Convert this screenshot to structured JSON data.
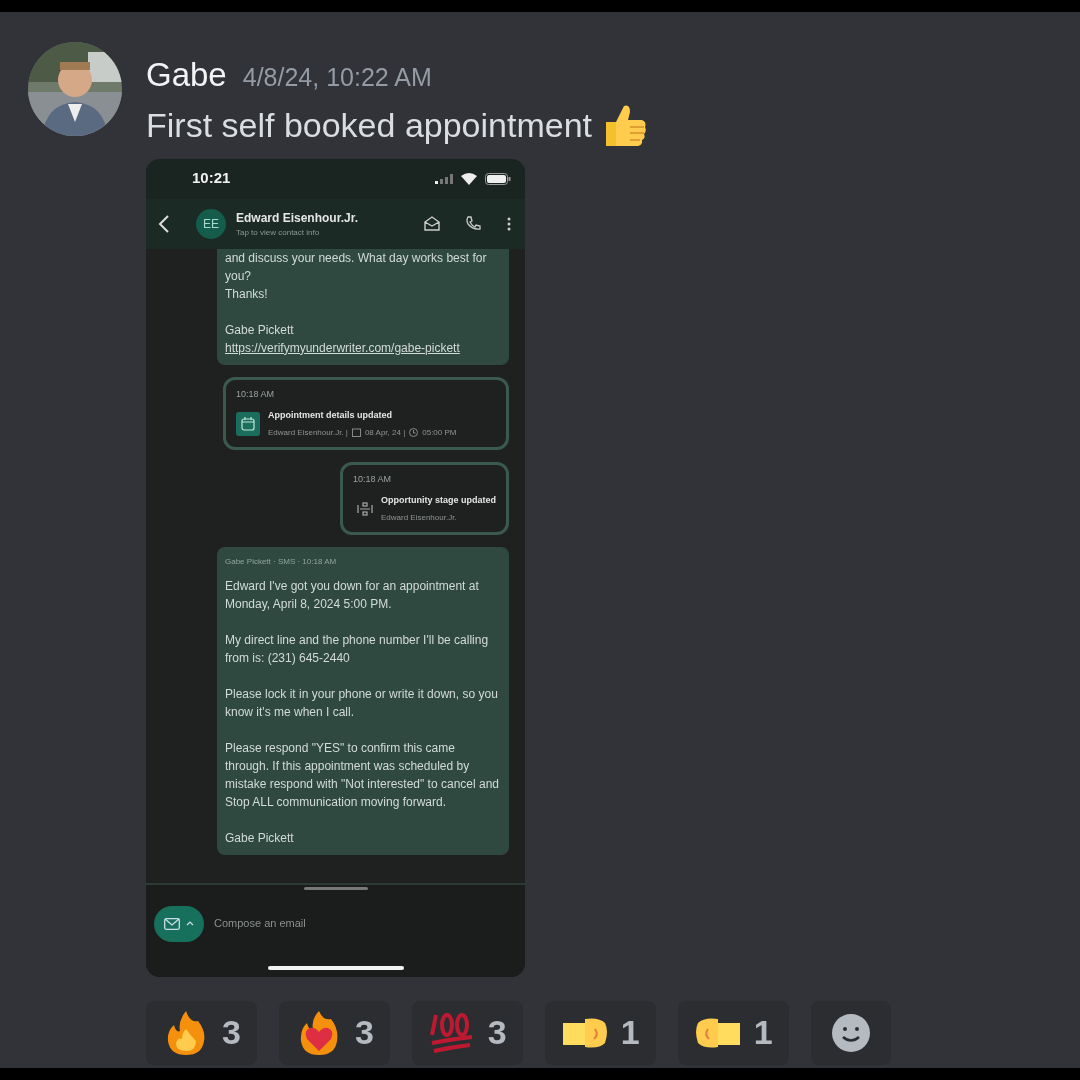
{
  "message": {
    "author": "Gabe",
    "timestamp": "4/8/24, 10:22 AM",
    "text": "First self booked appointment"
  },
  "phone": {
    "time": "10:21",
    "contact": {
      "initials": "EE",
      "name": "Edward Eisenhour.Jr.",
      "subtitle": "Tap to view contact info"
    },
    "messages": [
      {
        "kind": "sms",
        "body": "and discuss your needs. What day works best for you?\nThanks!\n\nGabe Pickett",
        "link": "https://verifymyunderwriter.com/gabe-pickett"
      },
      {
        "kind": "appointment",
        "time": "10:18 AM",
        "title": "Appointment details updated",
        "person": "Edward Eisenhour.Jr. |",
        "date": "08 Apr, 24 |",
        "clock": "05:00 PM"
      },
      {
        "kind": "stage",
        "time": "10:18 AM",
        "title": "Opportunity stage updated",
        "person": "Edward Eisenhour.Jr."
      },
      {
        "kind": "sms",
        "header": "Gabe Pickett · SMS · 10:18 AM",
        "body": "Edward I've got you down for an appointment at Monday, April 8, 2024 5:00 PM.\n\nMy direct line and the phone number I'll be calling from is: (231) 645-2440\n\nPlease lock it in your phone or write it down, so you know it's me when I call.\n\nPlease respond \"YES\" to confirm this came through.  If this appointment was scheduled by mistake respond with \"Not interested\" to cancel and Stop ALL communication moving forward.\n\nGabe Pickett"
      }
    ],
    "composer": {
      "placeholder": "Compose an email"
    }
  },
  "reactions": [
    {
      "kind": "fire",
      "count": "3"
    },
    {
      "kind": "heart_fire",
      "count": "3"
    },
    {
      "kind": "hundred",
      "count": "3"
    },
    {
      "kind": "fist_left",
      "count": "1"
    },
    {
      "kind": "fist_right",
      "count": "1"
    }
  ]
}
